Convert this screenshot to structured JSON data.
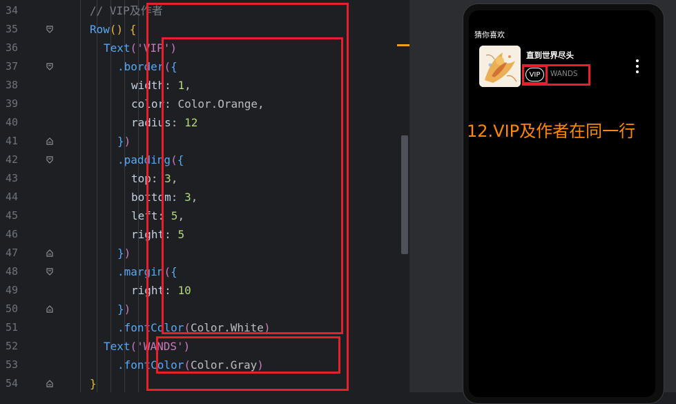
{
  "editor": {
    "gutter": [
      {
        "n": "34",
        "fold": ""
      },
      {
        "n": "35",
        "fold": "open"
      },
      {
        "n": "36",
        "fold": ""
      },
      {
        "n": "37",
        "fold": "open"
      },
      {
        "n": "38",
        "fold": ""
      },
      {
        "n": "39",
        "fold": ""
      },
      {
        "n": "40",
        "fold": ""
      },
      {
        "n": "41",
        "fold": "close"
      },
      {
        "n": "42",
        "fold": "open"
      },
      {
        "n": "43",
        "fold": ""
      },
      {
        "n": "44",
        "fold": ""
      },
      {
        "n": "45",
        "fold": ""
      },
      {
        "n": "46",
        "fold": ""
      },
      {
        "n": "47",
        "fold": "close"
      },
      {
        "n": "48",
        "fold": "open"
      },
      {
        "n": "49",
        "fold": ""
      },
      {
        "n": "50",
        "fold": "close"
      },
      {
        "n": "51",
        "fold": ""
      },
      {
        "n": "52",
        "fold": ""
      },
      {
        "n": "53",
        "fold": ""
      },
      {
        "n": "54",
        "fold": "close"
      }
    ],
    "lines": [
      [
        {
          "t": "// VIP及作者",
          "c": "com"
        }
      ],
      [
        {
          "t": "Row",
          "c": "fn"
        },
        {
          "t": "()",
          "c": "b1"
        },
        {
          "t": " {",
          "c": "b1"
        }
      ],
      [
        {
          "t": "Text",
          "c": "fn"
        },
        {
          "t": "(",
          "c": "b2"
        },
        {
          "t": "'VIP'",
          "c": "str"
        },
        {
          "t": ")",
          "c": "b2"
        }
      ],
      [
        {
          "t": ".border",
          "c": "method"
        },
        {
          "t": "(",
          "c": "b2"
        },
        {
          "t": "{",
          "c": "b3"
        }
      ],
      [
        {
          "t": "width",
          "c": "prop"
        },
        {
          "t": ": ",
          "c": "plain"
        },
        {
          "t": "1",
          "c": "num2"
        },
        {
          "t": ",",
          "c": "plain"
        }
      ],
      [
        {
          "t": "color",
          "c": "prop"
        },
        {
          "t": ": Color.Orange,",
          "c": "plain"
        }
      ],
      [
        {
          "t": "radius",
          "c": "prop"
        },
        {
          "t": ": ",
          "c": "plain"
        },
        {
          "t": "12",
          "c": "num2"
        }
      ],
      [
        {
          "t": "}",
          "c": "b3"
        },
        {
          "t": ")",
          "c": "b2"
        }
      ],
      [
        {
          "t": ".padding",
          "c": "method"
        },
        {
          "t": "(",
          "c": "b2"
        },
        {
          "t": "{",
          "c": "b3"
        }
      ],
      [
        {
          "t": "top",
          "c": "prop"
        },
        {
          "t": ": ",
          "c": "plain"
        },
        {
          "t": "3",
          "c": "num2"
        },
        {
          "t": ",",
          "c": "plain"
        }
      ],
      [
        {
          "t": "bottom",
          "c": "prop"
        },
        {
          "t": ": ",
          "c": "plain"
        },
        {
          "t": "3",
          "c": "num2"
        },
        {
          "t": ",",
          "c": "plain"
        }
      ],
      [
        {
          "t": "left",
          "c": "prop"
        },
        {
          "t": ": ",
          "c": "plain"
        },
        {
          "t": "5",
          "c": "num2"
        },
        {
          "t": ",",
          "c": "plain"
        }
      ],
      [
        {
          "t": "right",
          "c": "prop"
        },
        {
          "t": ": ",
          "c": "plain"
        },
        {
          "t": "5",
          "c": "num2"
        }
      ],
      [
        {
          "t": "}",
          "c": "b3"
        },
        {
          "t": ")",
          "c": "b2"
        }
      ],
      [
        {
          "t": ".margin",
          "c": "method"
        },
        {
          "t": "(",
          "c": "b2"
        },
        {
          "t": "{",
          "c": "b3"
        }
      ],
      [
        {
          "t": "right",
          "c": "prop"
        },
        {
          "t": ": ",
          "c": "plain"
        },
        {
          "t": "10",
          "c": "num2"
        }
      ],
      [
        {
          "t": "}",
          "c": "b3"
        },
        {
          "t": ")",
          "c": "b2"
        }
      ],
      [
        {
          "t": ".fontColor",
          "c": "method"
        },
        {
          "t": "(",
          "c": "b2"
        },
        {
          "t": "Color.White",
          "c": "plain"
        },
        {
          "t": ")",
          "c": "b2"
        }
      ],
      [
        {
          "t": "Text",
          "c": "fn"
        },
        {
          "t": "(",
          "c": "b2"
        },
        {
          "t": "'WANDS'",
          "c": "str"
        },
        {
          "t": ")",
          "c": "b2"
        }
      ],
      [
        {
          "t": ".fontColor",
          "c": "method"
        },
        {
          "t": "(",
          "c": "b2"
        },
        {
          "t": "Color.Gray",
          "c": "plain"
        },
        {
          "t": ")",
          "c": "b2"
        }
      ],
      [
        {
          "t": "}",
          "c": "b1"
        }
      ]
    ]
  },
  "preview": {
    "section_title": "猜你喜欢",
    "song_title": "直到世界尽头",
    "vip_label": "VIP",
    "artist": "WANDS",
    "annotation": "12.VIP及作者在同一行"
  },
  "colors": {
    "annotation": "#ff8a00",
    "highlight_box": "#e8202e"
  }
}
